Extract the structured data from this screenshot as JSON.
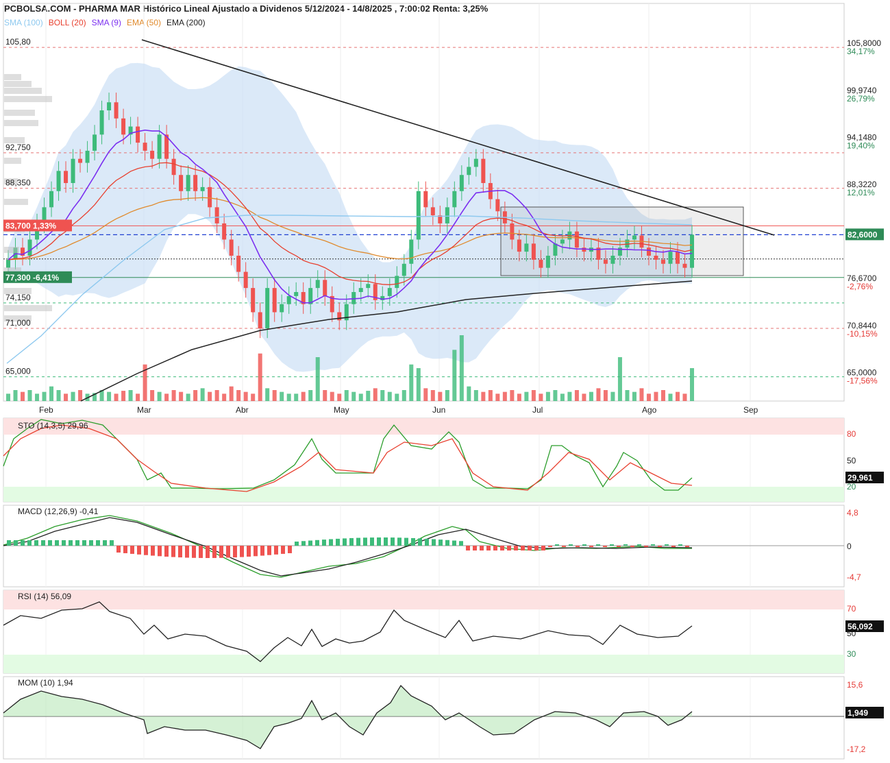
{
  "header": {
    "title": "PCBOLSA.COM - PHARMA MAR Histórico Lineal Ajustado a Dividenos 5/12/2024 - 14/8/2025 , 7:00:02 Renta: 3,25%"
  },
  "legend": [
    {
      "label": "SMA (100)",
      "color": "#8ec9ef"
    },
    {
      "label": "BOLL (20)",
      "color": "#e8402f"
    },
    {
      "label": "SMA (9)",
      "color": "#7b2ff0"
    },
    {
      "label": "EMA (50)",
      "color": "#e08a2c"
    },
    {
      "label": "EMA (200)",
      "color": "#222222"
    }
  ],
  "colors": {
    "up": "#3dbb7a",
    "down": "#ef5350",
    "sma100": "#8ec9ef",
    "boll": "#e8402f",
    "sma9": "#7b2ff0",
    "ema50": "#e08a2c",
    "ema200": "#222222",
    "band": "#cfe2f6",
    "sto_k": "#2a9d2a",
    "sto_d": "#e8402f",
    "hline": "#e57373"
  },
  "price_axis": {
    "right_labels": [
      {
        "price": "105,8000",
        "pct": "34,17%"
      },
      {
        "price": "99,9740",
        "pct": "26,79%"
      },
      {
        "price": "94,1480",
        "pct": "19,40%"
      },
      {
        "price": "88,3220",
        "pct": "12,01%"
      },
      {
        "price": "76,6700",
        "pct": "-2,76%"
      },
      {
        "price": "70,8440",
        "pct": "-10,15%"
      },
      {
        "price": "65,0000",
        "pct": "-17,56%"
      }
    ],
    "current_price": "82,6000",
    "left_labels": [
      "105,80",
      "92,750",
      "88,350",
      "74,150",
      "71,000",
      "65,000"
    ],
    "tag_high": "83,700  1,33%",
    "tag_low": "77,300  -6,41%"
  },
  "months": [
    "Feb",
    "Mar",
    "Abr",
    "May",
    "Jun",
    "Jul",
    "Ago",
    "Sep"
  ],
  "sto": {
    "label": "STO (14,3,5)",
    "value": "29,96",
    "last": "29,961",
    "levels": [
      "80",
      "50",
      "20"
    ]
  },
  "macd": {
    "label": "MACD (12,26,9)",
    "value": "-0,41",
    "levels": [
      "4,8",
      "0",
      "-4,7"
    ]
  },
  "rsi": {
    "label": "RSI (14)",
    "value": "56,09",
    "last": "56,092",
    "levels": [
      "70",
      "50",
      "30"
    ]
  },
  "mom": {
    "label": "MOM (10)",
    "value": "1,94",
    "last": "1,949",
    "levels": [
      "15,6",
      "-17,2"
    ]
  },
  "chart_data": {
    "type": "line",
    "title": "PHARMA MAR Histórico Lineal Ajustado a Dividenos 5/12/2024 - 14/8/2025",
    "x": [
      "Feb",
      "Mar",
      "Abr",
      "May",
      "Jun",
      "Jul",
      "Ago",
      "Sep"
    ],
    "ylim": [
      62,
      107
    ],
    "series": [
      {
        "name": "SMA (9)",
        "values": [
          77,
          83,
          89,
          96,
          94,
          80,
          75,
          74.5,
          79,
          86,
          89,
          82,
          81,
          80,
          79
        ]
      },
      {
        "name": "EMA (200)",
        "values": [
          62,
          66,
          69,
          71,
          72.5,
          74,
          75,
          75.8,
          76.2,
          76.5
        ]
      }
    ],
    "close": [
      79.5,
      81,
      80,
      82,
      84,
      86,
      88,
      90.5,
      89,
      92,
      91.5,
      93,
      95,
      98,
      99,
      97,
      95,
      96,
      94,
      93,
      92,
      95,
      92,
      90,
      88,
      90,
      88,
      88.5,
      86,
      84,
      82,
      80,
      78,
      76,
      73,
      71,
      76,
      73,
      74,
      75,
      75.5,
      74,
      76,
      77,
      75,
      73,
      72,
      74,
      75.5,
      76,
      76.5,
      74.5,
      75,
      76,
      77.5,
      79,
      82,
      88,
      86,
      85,
      84,
      86,
      88,
      90,
      91,
      92,
      89,
      87,
      85.5,
      84,
      82,
      80.5,
      81.5,
      79.5,
      78.5,
      80,
      81.5,
      82,
      83,
      81,
      80.5,
      81,
      79.5,
      79,
      80,
      81,
      82,
      82.5,
      81,
      80,
      79.5,
      79,
      80.5,
      79,
      78.5,
      82.6
    ],
    "volume": [
      0.2,
      0.3,
      0.25,
      0.3,
      0.2,
      0.25,
      0.4,
      0.3,
      0.2,
      0.25,
      0.3,
      0.2,
      0.22,
      0.3,
      0.25,
      0.2,
      0.28,
      0.3,
      0.2,
      1.0,
      0.3,
      0.25,
      0.2,
      0.3,
      0.25,
      0.2,
      0.3,
      0.35,
      0.25,
      0.3,
      0.2,
      0.4,
      0.3,
      0.25,
      0.2,
      1.3,
      0.35,
      0.3,
      0.25,
      0.2,
      0.2,
      0.25,
      0.3,
      1.2,
      0.3,
      0.25,
      0.2,
      0.3,
      0.25,
      0.2,
      0.28,
      0.35,
      0.3,
      0.25,
      0.2,
      0.3,
      1.0,
      0.9,
      0.35,
      0.3,
      0.25,
      0.3,
      1.4,
      1.8,
      0.4,
      0.3,
      0.25,
      0.3,
      0.2,
      0.25,
      0.3,
      0.2,
      0.25,
      0.3,
      0.2,
      0.25,
      0.3,
      0.2,
      0.25,
      0.3,
      0.2,
      0.25,
      0.35,
      0.3,
      0.25,
      1.2,
      0.3,
      0.25,
      0.35,
      0.2,
      0.25,
      0.3,
      0.2,
      0.25,
      0.2,
      0.9
    ]
  }
}
